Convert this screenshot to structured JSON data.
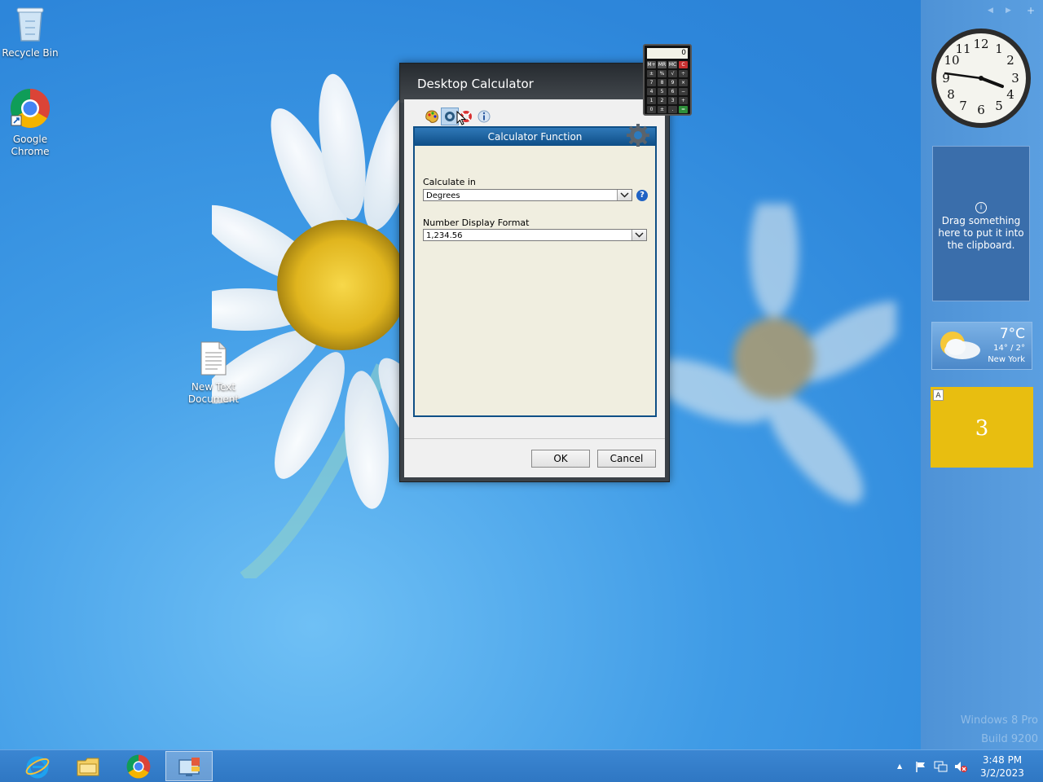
{
  "desktop": {
    "icons": [
      {
        "label": "Recycle Bin"
      },
      {
        "label": "Google Chrome"
      },
      {
        "label": "New Text Document"
      }
    ]
  },
  "dialog": {
    "title": "Desktop Calculator",
    "panel_title": "Calculator Function",
    "calculate_in_label": "Calculate in",
    "calculate_in_value": "Degrees",
    "number_format_label": "Number Display Format",
    "number_format_value": "1,234.56",
    "help_glyph": "?",
    "ok_label": "OK",
    "cancel_label": "Cancel",
    "tab_icons": [
      "paint-palette-icon",
      "gear-icon",
      "lifebuoy-icon",
      "info-icon"
    ]
  },
  "calculator_gadget": {
    "display": "0",
    "keys": [
      [
        "M+",
        "MR",
        "MC",
        "C"
      ],
      [
        "±",
        "%",
        "√",
        "÷"
      ],
      [
        "7",
        "8",
        "9",
        "×"
      ],
      [
        "4",
        "5",
        "6",
        "−"
      ],
      [
        "1",
        "2",
        "3",
        "+"
      ],
      [
        "0",
        "±",
        ".",
        "="
      ]
    ]
  },
  "sidebar": {
    "nav": [
      "◀",
      "▶",
      "+"
    ],
    "clipboard_msg": "Drag something here to put it into the clipboard.",
    "clipboard_icon": "i",
    "weather": {
      "temp": "7°C",
      "range": "14° / 2°",
      "city": "New York"
    },
    "sticky_tag": "A",
    "sticky_value": "3",
    "watermark_line1": "Windows 8 Pro",
    "watermark_line2": "Build 9200"
  },
  "taskbar": {
    "apps": [
      "internet-explorer-icon",
      "file-explorer-icon",
      "chrome-icon",
      "desktop-gadget-icon"
    ],
    "time": "3:48 PM",
    "date": "3/2/2023",
    "tray_arrow": "▲"
  },
  "colors": {
    "accent": "#0e4e86",
    "sticky": "#e8be10",
    "desktop": "#2d86da"
  }
}
